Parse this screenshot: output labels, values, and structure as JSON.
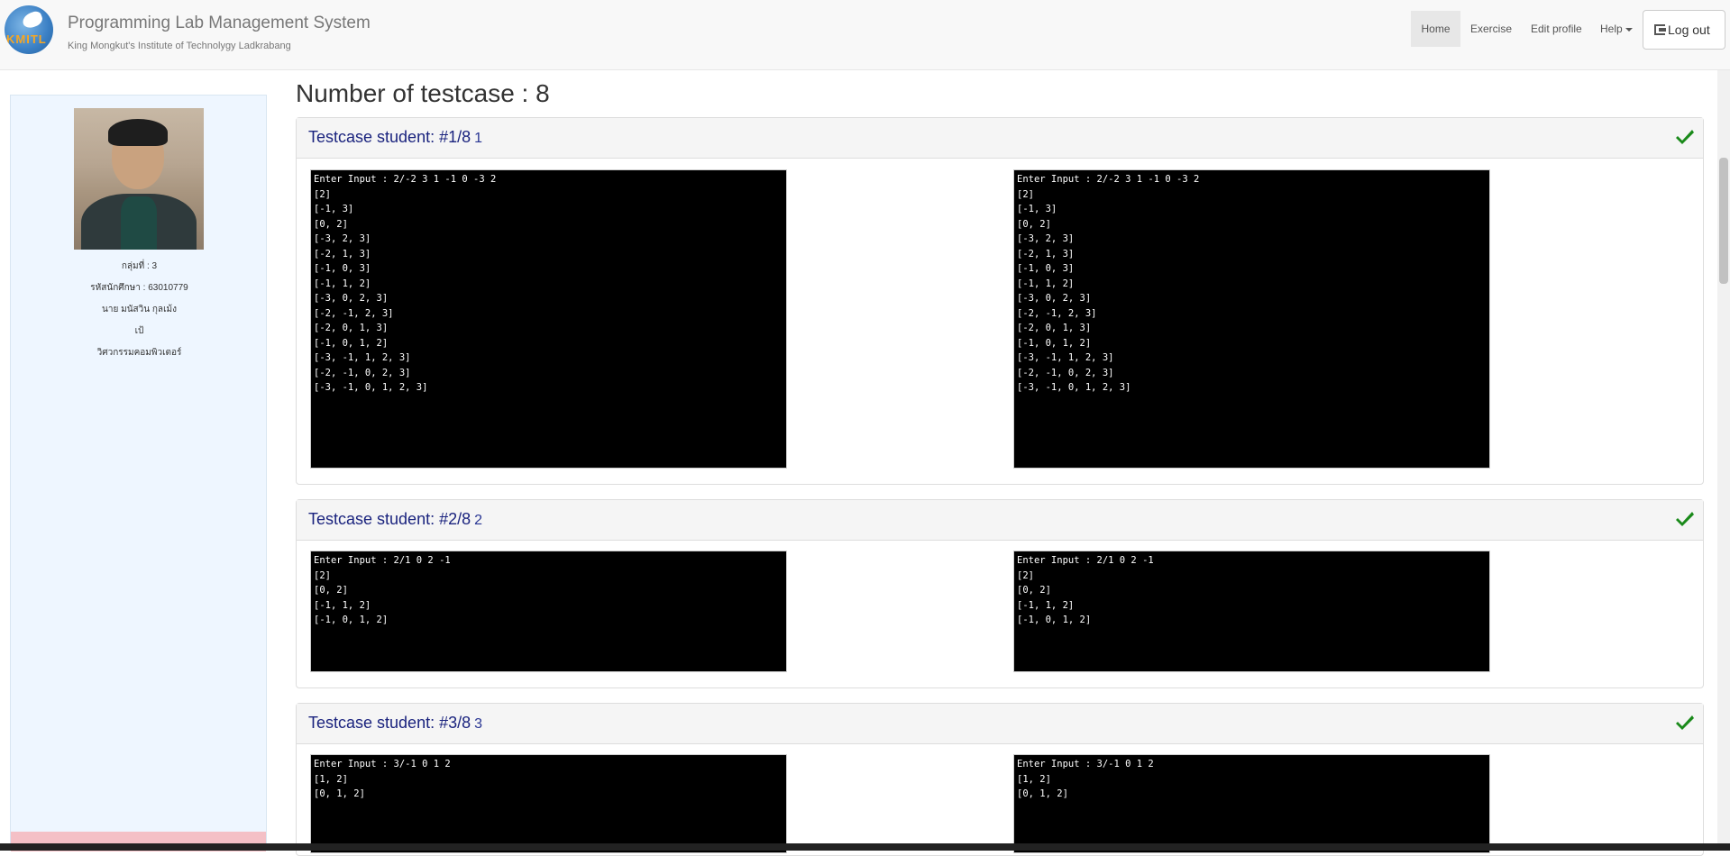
{
  "brand": {
    "logo_text": "KMITL",
    "title": "Programming Lab Management System",
    "subtitle": "King Mongkut's Institute of Technolygy Ladkrabang"
  },
  "nav": {
    "home": "Home",
    "exercise": "Exercise",
    "edit_profile": "Edit profile",
    "help": "Help",
    "logout": "Log out"
  },
  "profile": {
    "group": "กลุ่มที่ : 3",
    "student_id": "รหัสนักศึกษา : 63010779",
    "name": "นาย มนัสวิน กุลเม้ง",
    "nickname": "เป้",
    "faculty": "วิศวกรรมคอมพิวเตอร์"
  },
  "main": {
    "heading": "Number of testcase : 8"
  },
  "testcases": [
    {
      "title": "Testcase student: #1/8",
      "num": "1",
      "status": "passed",
      "student_output": "Enter Input : 2/-2 3 1 -1 0 -3 2\n[2]\n[-1, 3]\n[0, 2]\n[-3, 2, 3]\n[-2, 1, 3]\n[-1, 0, 3]\n[-1, 1, 2]\n[-3, 0, 2, 3]\n[-2, -1, 2, 3]\n[-2, 0, 1, 3]\n[-1, 0, 1, 2]\n[-3, -1, 1, 2, 3]\n[-2, -1, 0, 2, 3]\n[-3, -1, 0, 1, 2, 3]",
      "expected_output": "Enter Input : 2/-2 3 1 -1 0 -3 2\n[2]\n[-1, 3]\n[0, 2]\n[-3, 2, 3]\n[-2, 1, 3]\n[-1, 0, 3]\n[-1, 1, 2]\n[-3, 0, 2, 3]\n[-2, -1, 2, 3]\n[-2, 0, 1, 3]\n[-1, 0, 1, 2]\n[-3, -1, 1, 2, 3]\n[-2, -1, 0, 2, 3]\n[-3, -1, 0, 1, 2, 3]"
    },
    {
      "title": "Testcase student: #2/8",
      "num": "2",
      "status": "passed",
      "student_output": "Enter Input : 2/1 0 2 -1\n[2]\n[0, 2]\n[-1, 1, 2]\n[-1, 0, 1, 2]",
      "expected_output": "Enter Input : 2/1 0 2 -1\n[2]\n[0, 2]\n[-1, 1, 2]\n[-1, 0, 1, 2]"
    },
    {
      "title": "Testcase student: #3/8",
      "num": "3",
      "status": "passed",
      "student_output": "Enter Input : 3/-1 0 1 2\n[1, 2]\n[0, 1, 2]",
      "expected_output": "Enter Input : 3/-1 0 1 2\n[1, 2]\n[0, 1, 2]"
    }
  ],
  "colors": {
    "check": "#1a8a1a",
    "title_blue": "#1a237e",
    "sidebar_bg": "#eef6ff"
  }
}
